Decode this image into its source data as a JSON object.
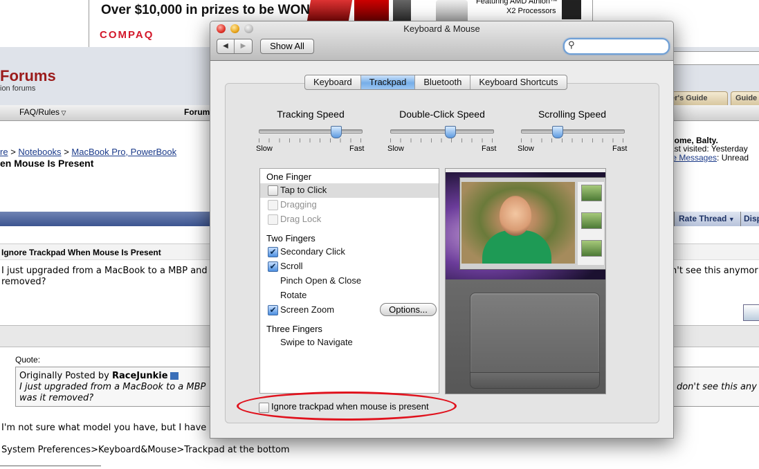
{
  "banner": {
    "headline": "Over $10,000 in prizes to be WON",
    "brand": "COMPAQ",
    "amd_line1": "Featuring AMD Athlon™",
    "amd_line2": "X2 Processors"
  },
  "site": {
    "title": "Forums",
    "subtitle": "ion forums",
    "tabs": [
      "yer's Guide",
      "Guide"
    ]
  },
  "nav": {
    "faq": "FAQ/Rules",
    "forum": "Forum"
  },
  "breadcrumb": {
    "prefix": "re",
    "sep": ">",
    "items": [
      "Notebooks",
      "MacBook Pro, PowerBook"
    ]
  },
  "thread": {
    "title": "en Mouse Is Present",
    "rate_thread": "Rate Thread",
    "display": "Disp"
  },
  "user": {
    "welcome": "come, Balty.",
    "last_visited": "ast visited: Yesterday",
    "pm_link": "te Messages",
    "pm_suffix": ": Unread"
  },
  "post1": {
    "title": "Ignore Trackpad When Mouse Is Present",
    "line1": "I just upgraded from a MacBook to a MBP and",
    "line2": "removed?",
    "right": "n't see this anymor"
  },
  "reply": {
    "quote_label": "Quote:",
    "quote_prefix": "Originally Posted by ",
    "quote_author": "RaceJunkie",
    "quote_line1": "I just upgraded from a MacBook to a MBP",
    "quote_line2": "was it removed?",
    "quote_right": "I don't see this any",
    "line1": "I'm not sure what model you have, but I have",
    "line2": "System Preferences>Keyboard&Mouse>Trackpad at the bottom"
  },
  "window": {
    "title": "Keyboard & Mouse",
    "back": "◀",
    "forward": "▶",
    "show_all": "Show All",
    "search_icon": "⚲",
    "tabs": [
      "Keyboard",
      "Trackpad",
      "Bluetooth",
      "Keyboard Shortcuts"
    ],
    "selected_tab": "Trackpad"
  },
  "sliders": {
    "tracking": {
      "label": "Tracking Speed",
      "min": "Slow",
      "max": "Fast",
      "value": 0.75
    },
    "doubleclick": {
      "label": "Double-Click Speed",
      "min": "Slow",
      "max": "Fast",
      "value": 0.58
    },
    "scrolling": {
      "label": "Scrolling Speed",
      "min": "Slow",
      "max": "Fast",
      "value": 0.35
    }
  },
  "gestures": {
    "one_finger": "One Finger",
    "tap_to_click": "Tap to Click",
    "dragging": "Dragging",
    "drag_lock": "Drag Lock",
    "two_fingers": "Two Fingers",
    "secondary_click": "Secondary Click",
    "scroll": "Scroll",
    "pinch": "Pinch Open & Close",
    "rotate": "Rotate",
    "screen_zoom": "Screen Zoom",
    "options": "Options...",
    "three_fingers": "Three Fingers",
    "swipe": "Swipe to Navigate",
    "check": "✔"
  },
  "ignore_trackpad": "Ignore trackpad when mouse is present",
  "colors": {
    "highlight_oval": "#e0121d",
    "selected_tab": "#76aee8",
    "forum_red": "#9b1b1b"
  }
}
